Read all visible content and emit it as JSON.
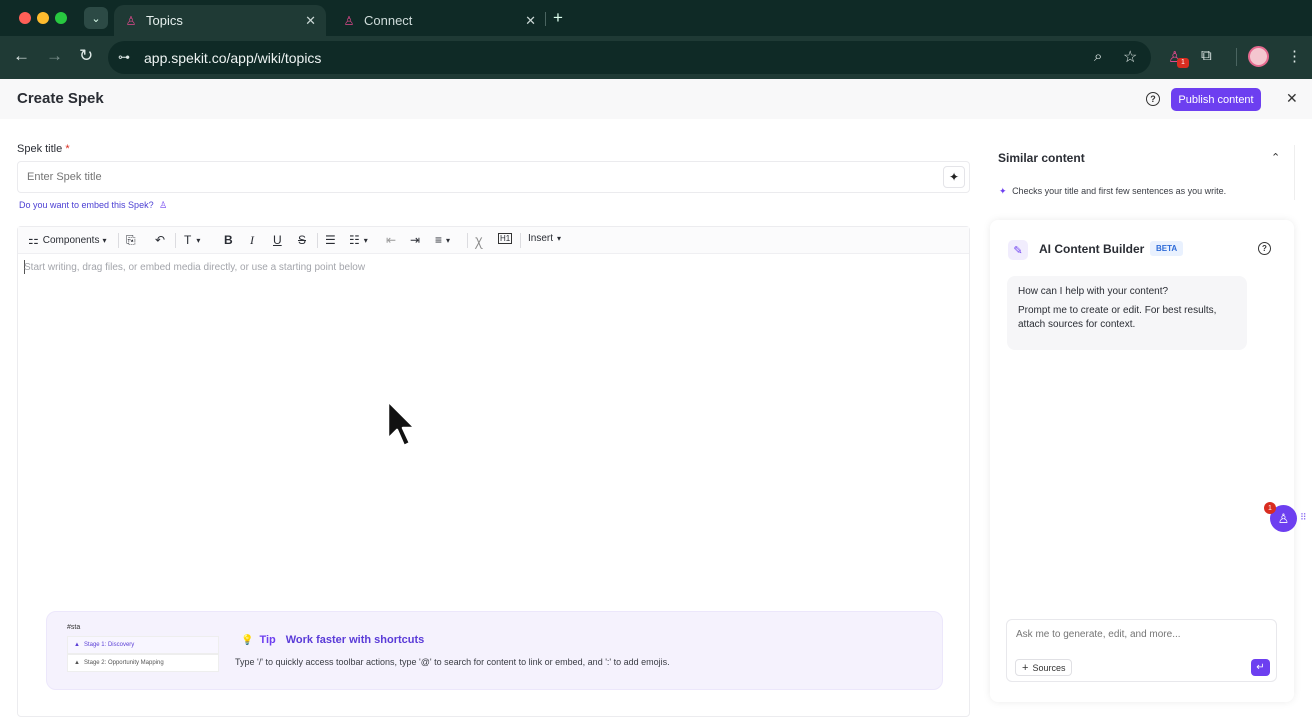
{
  "browser": {
    "tabs": [
      {
        "label": "Topics",
        "active": true
      },
      {
        "label": "Connect",
        "active": false
      }
    ],
    "url": "app.spekit.co/app/wiki/topics",
    "extension_badge": "1"
  },
  "header": {
    "title": "Create Spek",
    "publish_label": "Publish content"
  },
  "form": {
    "title_label": "Spek title",
    "required_mark": "*",
    "title_placeholder": "Enter Spek title",
    "embed_prompt": "Do you want to embed this Spek?"
  },
  "toolbar": {
    "components_label": "Components",
    "insert_label": "Insert"
  },
  "editor": {
    "placeholder": "Start writing, drag files, or embed media directly, or use a starting point below"
  },
  "tip": {
    "tag": "Tip",
    "title": "Work faster with shortcuts",
    "description": "Type '/' to quickly access toolbar actions, type '@' to search for content to link or embed, and ':' to add emojis.",
    "mock_input": "#sta",
    "mock_items": [
      "Stage 1: Discovery",
      "Stage 2: Opportunity Mapping"
    ]
  },
  "similar": {
    "title": "Similar content",
    "note": "Checks your title and first few sentences as you write."
  },
  "ai_builder": {
    "title": "AI Content Builder",
    "badge": "BETA",
    "messages": [
      "How can I help with your content?",
      "Prompt me to create or edit. For best results, attach sources for context."
    ],
    "input_placeholder": "Ask me to generate, edit, and more...",
    "sources_label": "Sources"
  },
  "floating": {
    "badge": "1"
  },
  "colors": {
    "accent": "#6d3ff0",
    "browser_dark": "#0f2a26",
    "browser_mid": "#1f3a35"
  }
}
